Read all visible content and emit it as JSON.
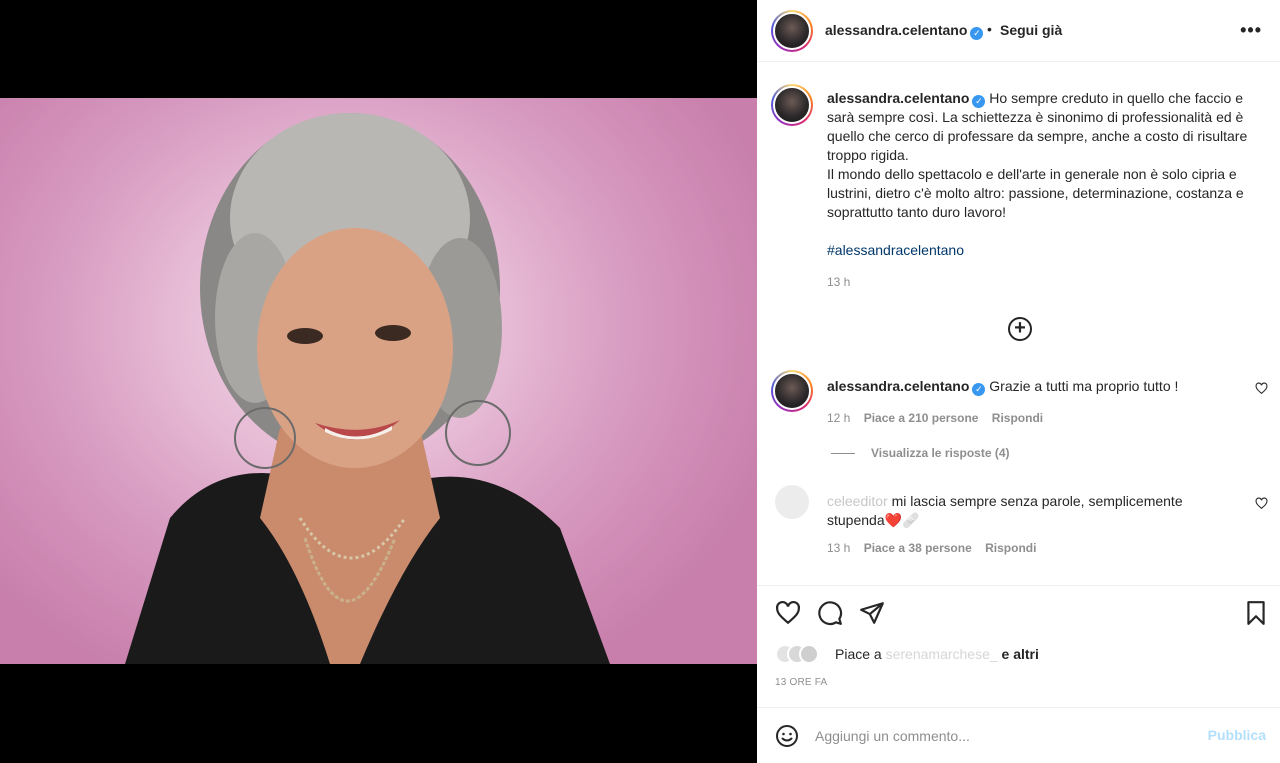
{
  "colors": {
    "accent": "#0095f6",
    "link": "#00376b",
    "muted": "#8e8e8e",
    "publish_disabled": "#b2dffc"
  },
  "header": {
    "username": "alessandra.celentano",
    "separator": "•",
    "follow_label": "Segui già",
    "more_icon": "more-horizontal-icon"
  },
  "caption": {
    "username": "alessandra.celentano",
    "lines": [
      "Ho sempre creduto in quello che faccio e sarà sempre così. La schiettezza è sinonimo di professionalità ed è quello che cerco di professare da sempre, anche a costo di risultare troppo rigida.",
      "Il mondo dello spettacolo e dell'arte in generale non è solo cipria e lustrini, dietro c'è molto altro: passione, determinazione, costanza e soprattutto tanto duro lavoro!"
    ],
    "hashtag": "#alessandracelentano",
    "time": "13 h"
  },
  "load_more_icon": "plus-circle-icon",
  "comments": [
    {
      "username": "alessandra.celentano",
      "text": "Grazie a tutti ma proprio tutto !",
      "time": "12 h",
      "likes": "Piace a 210 persone",
      "reply": "Rispondi",
      "view_replies": "Visualizza le risposte (4)"
    },
    {
      "username": "celeeditor",
      "text": "mi lascia sempre senza parole, semplicemente stupenda❤️🩹",
      "time": "13 h",
      "likes": "Piace a 38 persone",
      "reply": "Rispondi"
    }
  ],
  "actions": {
    "icons": [
      "heart-icon",
      "comment-icon",
      "share-icon",
      "bookmark-icon"
    ],
    "likes_prefix": "Piace a",
    "likes_user": "serenamarchese_",
    "likes_suffix": "e altri",
    "post_time": "13 ORE FA"
  },
  "add_comment": {
    "placeholder": "Aggiungi un commento...",
    "publish_label": "Pubblica"
  }
}
